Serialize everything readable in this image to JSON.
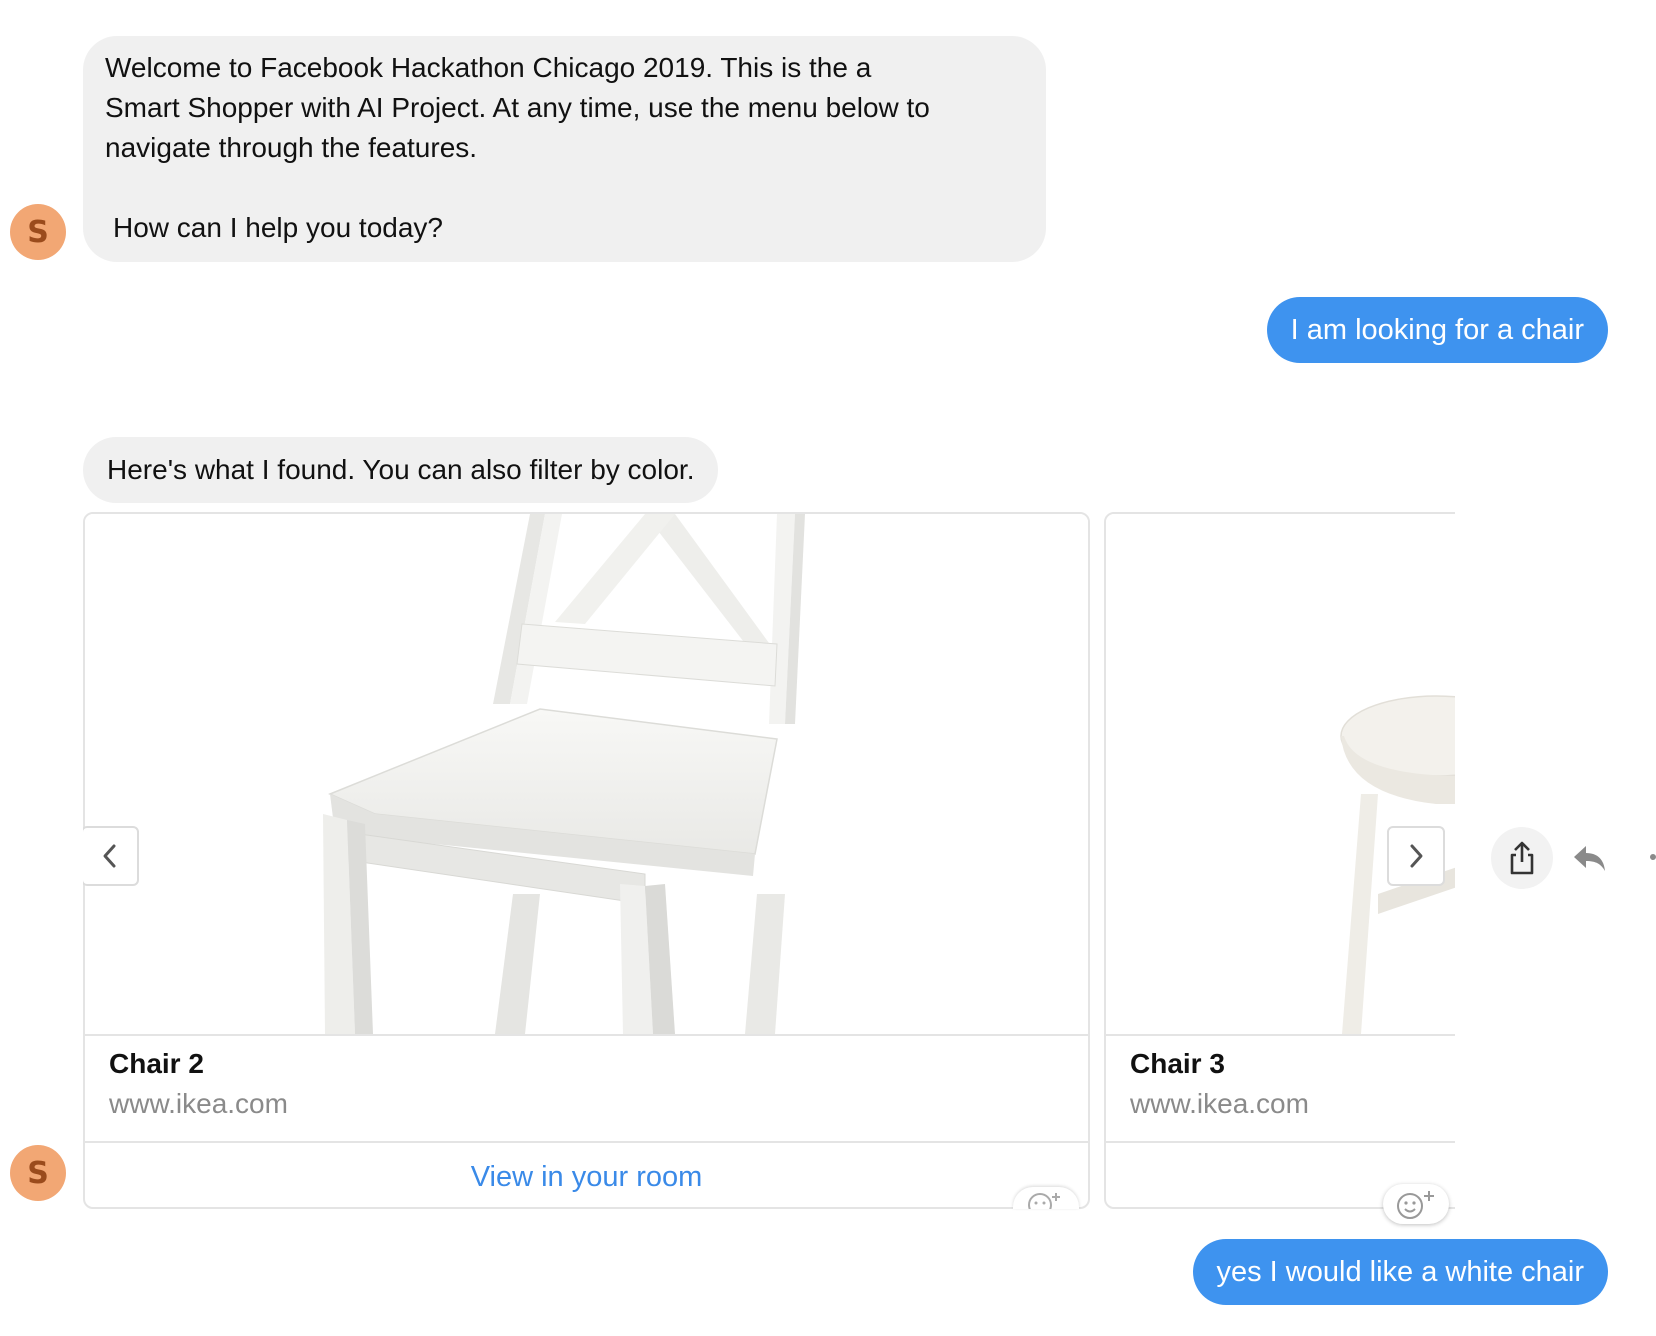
{
  "bot": {
    "avatar_letter": "S",
    "avatar_color": "#f2a774"
  },
  "messages": {
    "welcome": {
      "line1": "Welcome to Facebook Hackathon Chicago 2019. This is the a",
      "line2": "Smart Shopper with AI Project. At any time, use the menu below to",
      "line3": "navigate through the features.",
      "line4": "How can I help you today?"
    },
    "user_chair": "I am looking for a chair",
    "found": "Here's what I found. You can also filter by color.",
    "user_white": "yes I would like a white chair"
  },
  "carousel": {
    "cards": [
      {
        "title": "Chair 2",
        "subtitle": "www.ikea.com",
        "action": "View in your room"
      },
      {
        "title": "Chair 3",
        "subtitle": "www.ikea.com",
        "action": ""
      }
    ]
  },
  "colors": {
    "outgoing_bubble": "#3e93ef",
    "incoming_bubble": "#f0f0f0",
    "link": "#3a8ae8"
  },
  "icons": {
    "prev": "chevron-left-icon",
    "next": "chevron-right-icon",
    "share": "share-icon",
    "reply": "reply-icon",
    "more": "more-icon",
    "react": "add-reaction-icon"
  }
}
